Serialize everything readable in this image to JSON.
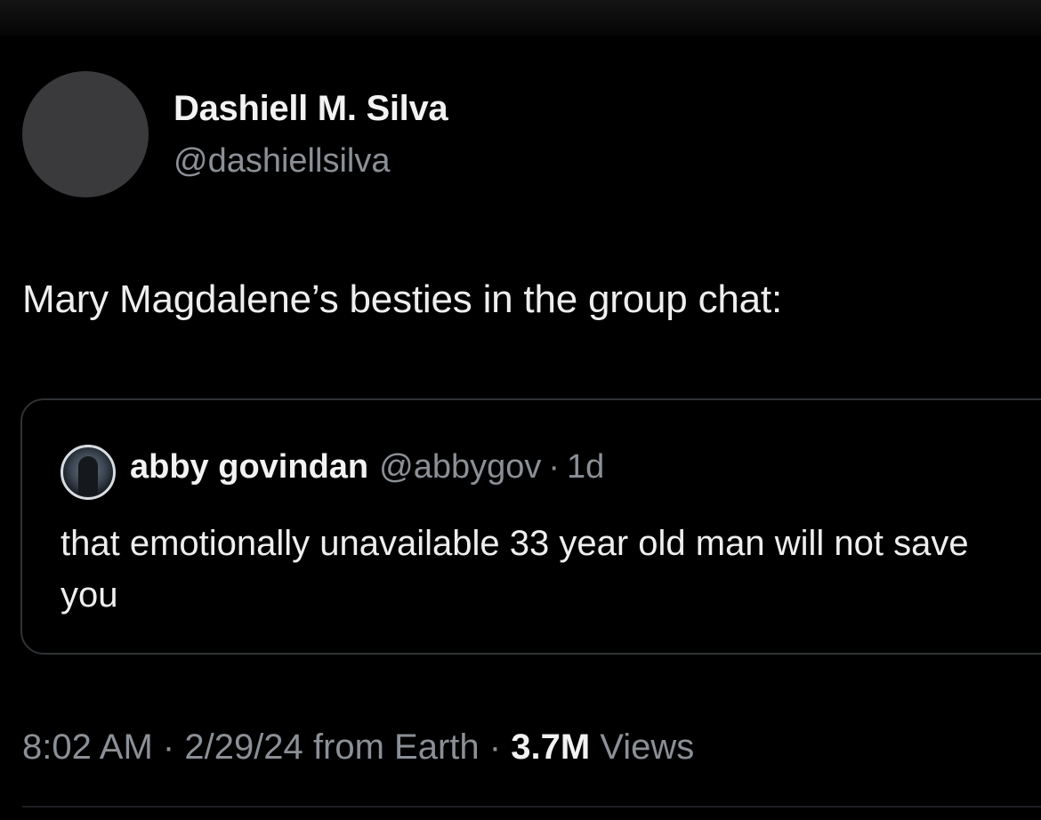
{
  "tweet": {
    "author": {
      "name": "Dashiell M. Silva",
      "handle": "@dashiellsilva"
    },
    "text": "Mary Magdalene’s besties in the group chat:",
    "quoted": {
      "name": "abby govindan",
      "handle": "@abbygov",
      "separator": "·",
      "time": "1d",
      "text": "that emotionally unavailable 33 year old man will not save you"
    },
    "meta": {
      "time": "8:02 AM",
      "separator": "·",
      "date": "2/29/24",
      "source": "from Earth",
      "views_count": "3.7M",
      "views_label": "Views"
    }
  },
  "colors": {
    "background": "#000000",
    "primary_text": "#e7e9ea",
    "secondary_text": "#8b9096",
    "border": "#2f3336"
  }
}
